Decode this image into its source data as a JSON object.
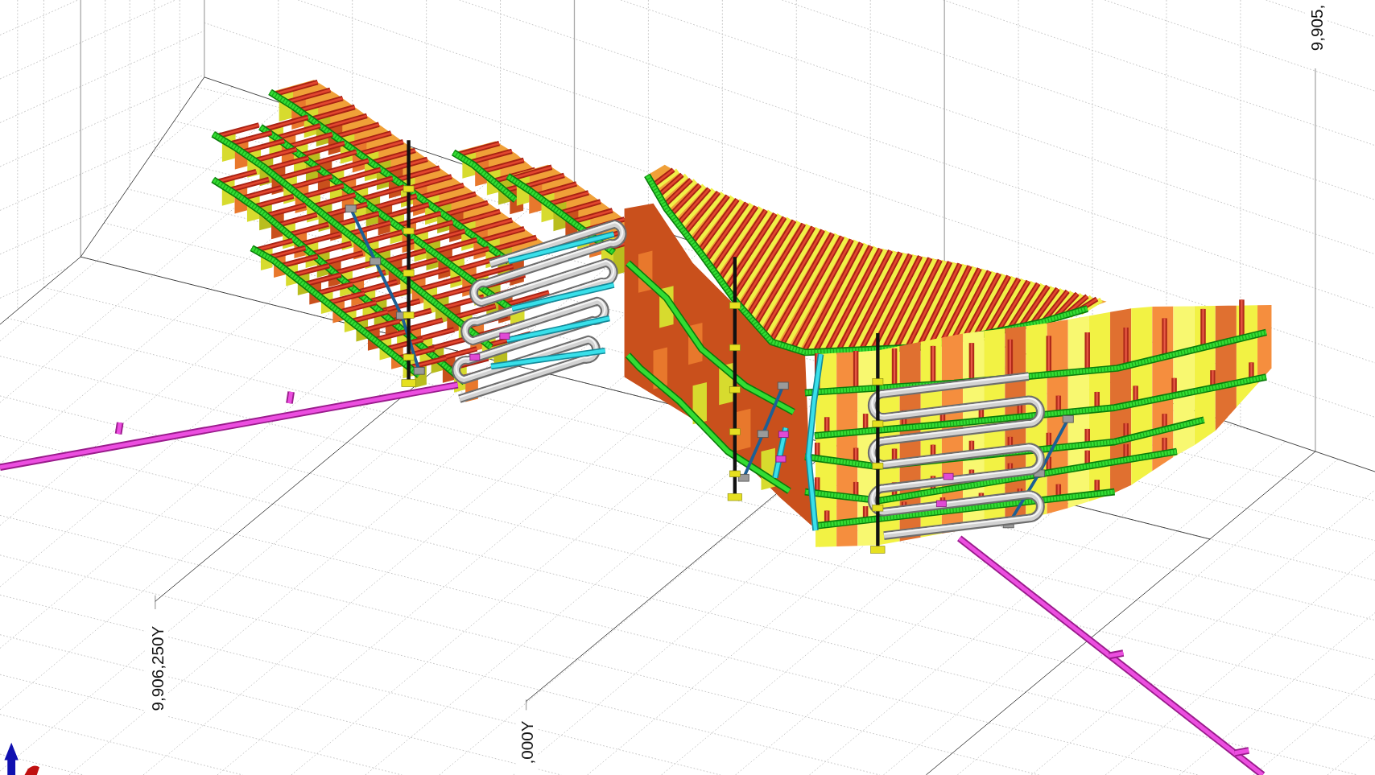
{
  "scene": {
    "axis_labels": [
      {
        "text": "9,905,"
      },
      {
        "text": "9,906,250Y"
      },
      {
        "text": ",000Y"
      }
    ]
  }
}
